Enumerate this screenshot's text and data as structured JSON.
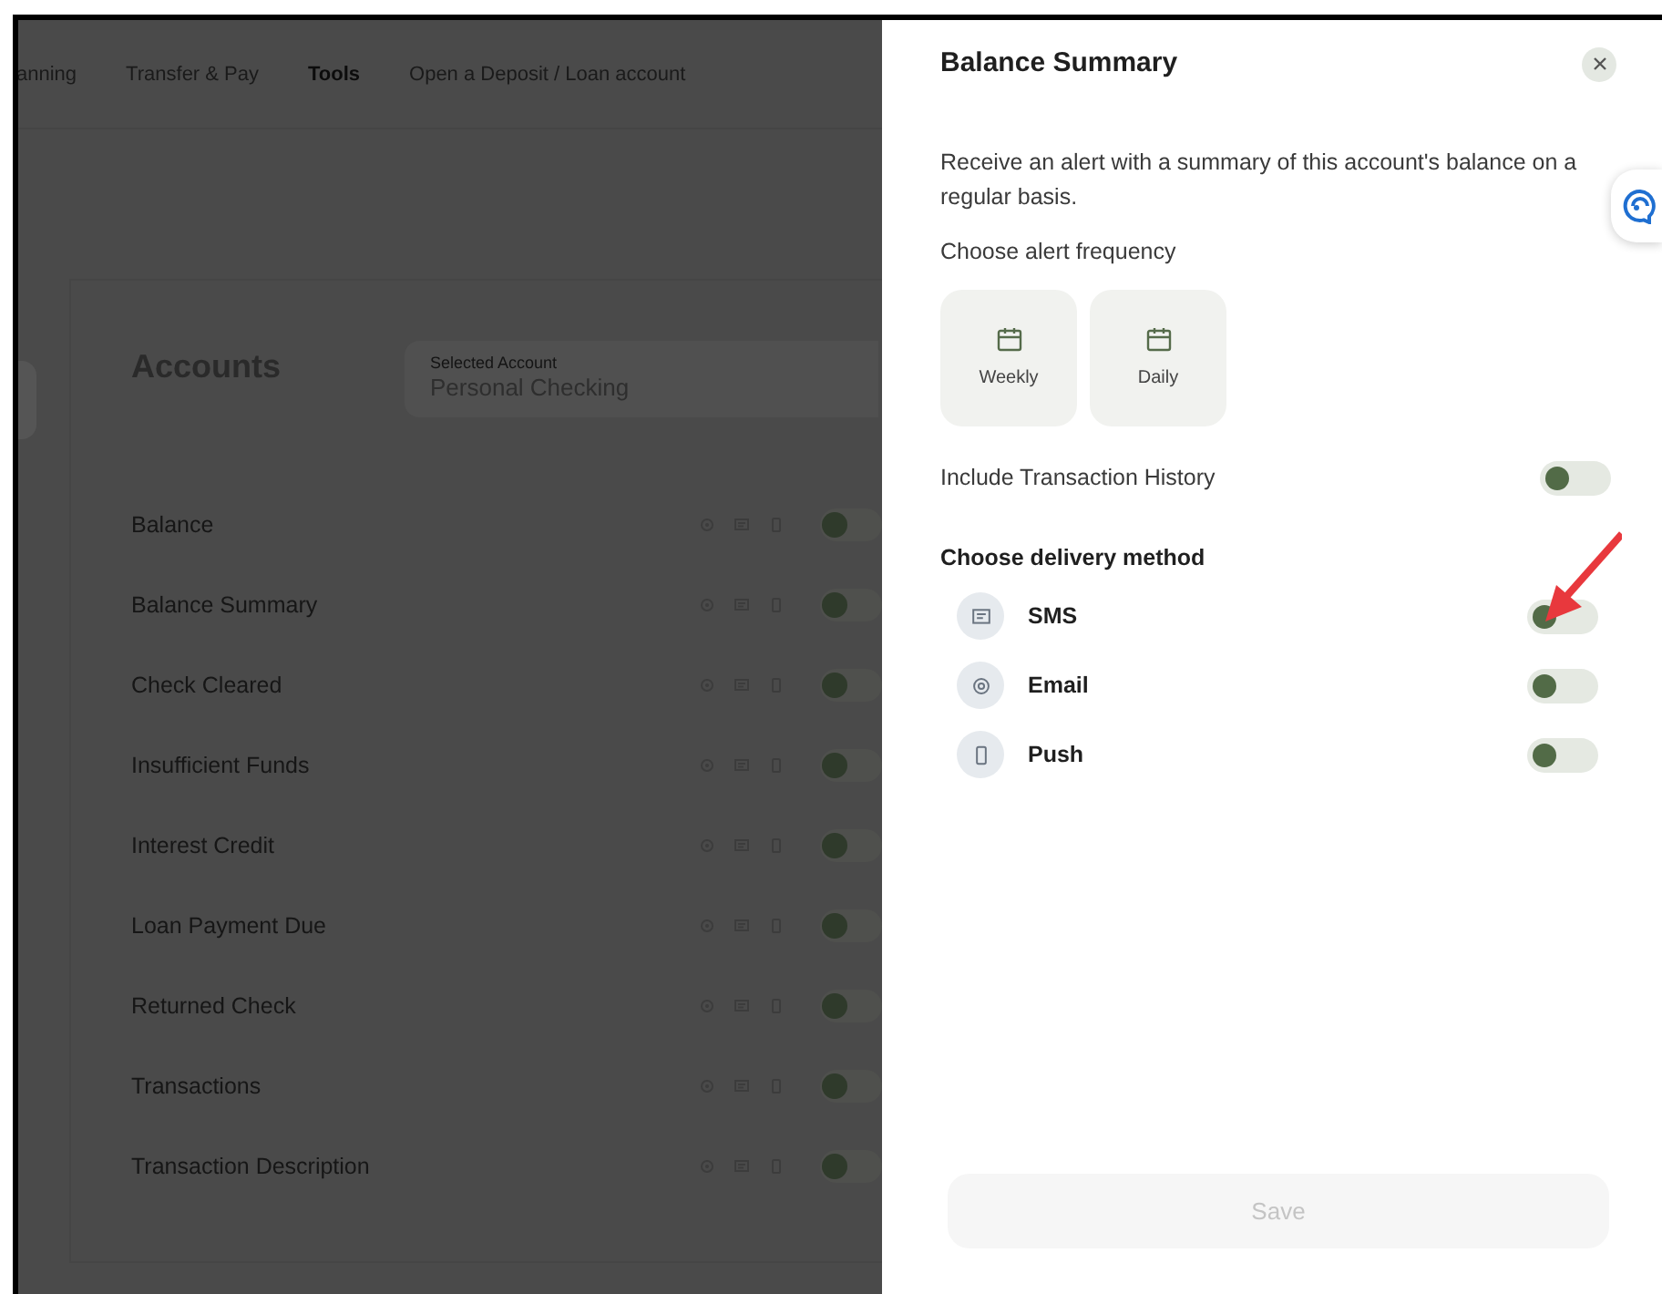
{
  "nav": [
    {
      "label": "anning",
      "selected": false
    },
    {
      "label": "Transfer & Pay",
      "selected": false
    },
    {
      "label": "Tools",
      "selected": true
    },
    {
      "label": "Open a Deposit / Loan account",
      "selected": false
    }
  ],
  "accounts": {
    "title": "Accounts",
    "selected_account": {
      "label": "Selected Account",
      "value": "Personal Checking"
    },
    "alerts": [
      {
        "name": "Balance",
        "on": false
      },
      {
        "name": "Balance Summary",
        "on": false
      },
      {
        "name": "Check Cleared",
        "on": false
      },
      {
        "name": "Insufficient Funds",
        "on": false
      },
      {
        "name": "Interest Credit",
        "on": false
      },
      {
        "name": "Loan Payment Due",
        "on": false
      },
      {
        "name": "Returned Check",
        "on": false
      },
      {
        "name": "Transactions",
        "on": false
      },
      {
        "name": "Transaction Description",
        "on": false
      }
    ]
  },
  "panel": {
    "title": "Balance Summary",
    "description": "Receive an alert with a summary of this account's balance on a regular basis.",
    "frequency_label": "Choose alert frequency",
    "frequencies": [
      {
        "label": "Weekly",
        "selected": false
      },
      {
        "label": "Daily",
        "selected": false
      }
    ],
    "history": {
      "label": "Include Transaction History",
      "on": false
    },
    "delivery_label": "Choose delivery method",
    "delivery": [
      {
        "kind": "sms",
        "label": "SMS",
        "on": false
      },
      {
        "kind": "email",
        "label": "Email",
        "on": false
      },
      {
        "kind": "push",
        "label": "Push",
        "on": false
      }
    ],
    "save": "Save"
  }
}
